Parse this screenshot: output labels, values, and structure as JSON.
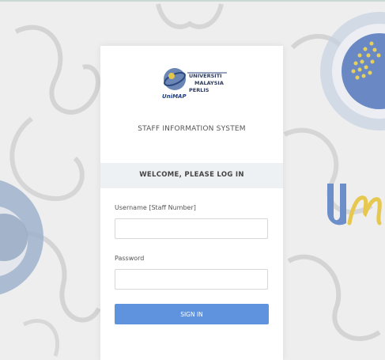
{
  "brand": {
    "logo_university_line1": "UNIVERSITI",
    "logo_university_line2": "MALAYSIA",
    "logo_university_line3": "PERLIS",
    "logo_mark": "UniMAP"
  },
  "system_title": "STAFF INFORMATION SYSTEM",
  "welcome_text": "WELCOME, PLEASE LOG IN",
  "form": {
    "username_label": "Username [Staff Number]",
    "username_value": "",
    "password_label": "Password",
    "password_value": "",
    "signin_label": "SIGN IN"
  },
  "colors": {
    "button": "#5f93dd",
    "welcome_bar": "#eef1f3",
    "background": "#eeeeee"
  }
}
